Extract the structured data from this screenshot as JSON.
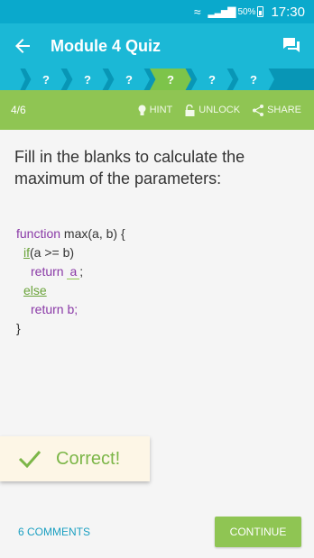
{
  "status": {
    "battery": "50%",
    "time": "17:30"
  },
  "app_bar": {
    "title": "Module 4 Quiz"
  },
  "progress": {
    "steps": [
      "?",
      "?",
      "?",
      "?",
      "?",
      "?"
    ],
    "active_index": 3
  },
  "toolbar": {
    "count": "4/6",
    "hint": "HINT",
    "unlock": "UNLOCK",
    "share": "SHARE"
  },
  "question": "Fill in the blanks to calculate the maximum of the parameters:",
  "code": {
    "l1_kw": "function",
    "l1_rest": " max(a, b) {",
    "l2_kw": "if",
    "l2_rest": "(a >= b)",
    "l3_kw": "return",
    "l3_ans": "a",
    "l3_end": ";",
    "l4_kw": "else",
    "l5_text": "return b;",
    "l6_text": "}"
  },
  "feedback": {
    "text": "Correct!"
  },
  "bottom": {
    "comments": "6 COMMENTS",
    "continue": "CONTINUE"
  },
  "colors": {
    "primary": "#1bb8d6",
    "green": "#8fc553",
    "keyword": "#8a3aa7"
  }
}
